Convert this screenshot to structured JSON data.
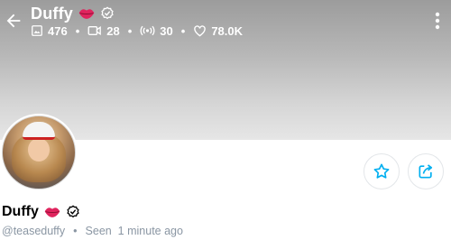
{
  "header": {
    "name": "Duffy",
    "stats": {
      "photos": "476",
      "videos": "28",
      "streams": "30",
      "likes": "78.0K"
    },
    "separator": "•"
  },
  "profile": {
    "name": "Duffy",
    "handle": "@teaseduffy",
    "separator": "•",
    "last_seen": "Seen  1 minute ago"
  },
  "icons": {
    "back": "arrow-left-icon",
    "more": "more-vertical-icon",
    "lips": "lips-icon",
    "verified": "verified-badge-icon",
    "photos": "image-icon",
    "videos": "video-icon",
    "streams": "broadcast-icon",
    "likes": "heart-icon",
    "favorite": "star-icon",
    "share": "share-icon"
  },
  "colors": {
    "accent": "#00aff0",
    "lips": "#e0245e",
    "muted": "#8a96a3"
  }
}
